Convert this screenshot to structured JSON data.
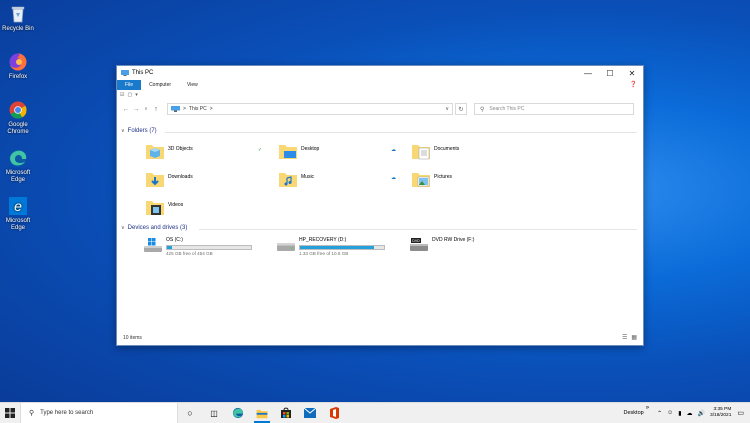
{
  "desktop": {
    "icons": [
      {
        "label": "Recycle Bin",
        "icon": "recycle-bin-icon"
      },
      {
        "label": "Firefox",
        "icon": "firefox-icon"
      },
      {
        "label": "Google Chrome",
        "icon": "chrome-icon"
      },
      {
        "label": "Microsoft Edge",
        "icon": "edge-icon"
      },
      {
        "label": "Microsoft Edge",
        "icon": "edge-legacy-icon"
      }
    ]
  },
  "window": {
    "title": "This PC",
    "ribbon_tabs": [
      "File",
      "Computer",
      "View"
    ],
    "address_location": "This PC",
    "address_separator": ">",
    "search_placeholder": "Search This PC",
    "folders_header": "Folders (7)",
    "folders": [
      {
        "name": "3D Objects",
        "icon": "3d-objects-folder-icon",
        "sync": "check"
      },
      {
        "name": "Desktop",
        "icon": "desktop-folder-icon",
        "sync": "cloud"
      },
      {
        "name": "Documents",
        "icon": "documents-folder-icon",
        "sync": ""
      },
      {
        "name": "Downloads",
        "icon": "downloads-folder-icon",
        "sync": ""
      },
      {
        "name": "Music",
        "icon": "music-folder-icon",
        "sync": "cloud"
      },
      {
        "name": "Pictures",
        "icon": "pictures-folder-icon",
        "sync": ""
      },
      {
        "name": "Videos",
        "icon": "videos-folder-icon",
        "sync": ""
      }
    ],
    "drives_header": "Devices and drives (3)",
    "drives": [
      {
        "name": "OS (C:)",
        "free_text": "425 GB free of 454 GB",
        "used_fraction": 0.064,
        "icon": "windows-drive-icon"
      },
      {
        "name": "HP_RECOVERY (D:)",
        "free_text": "1.33 GB free of 10.6 GB",
        "used_fraction": 0.875,
        "icon": "hard-drive-icon"
      },
      {
        "name": "DVD RW Drive (F:)",
        "free_text": "",
        "used_fraction": null,
        "icon": "dvd-drive-icon"
      }
    ],
    "status_text": "10 items"
  },
  "taskbar": {
    "search_placeholder": "Type here to search",
    "pinned": [
      "cortana-icon",
      "task-view-icon",
      "edge-icon",
      "file-explorer-icon",
      "store-icon",
      "mail-icon",
      "office-icon"
    ],
    "desktop_label": "Desktop",
    "time": "3:35 PM",
    "date": "3/18/2021"
  },
  "colors": {
    "accent": "#1979ca",
    "progress": "#26a0da",
    "section_header": "#1e3287"
  }
}
